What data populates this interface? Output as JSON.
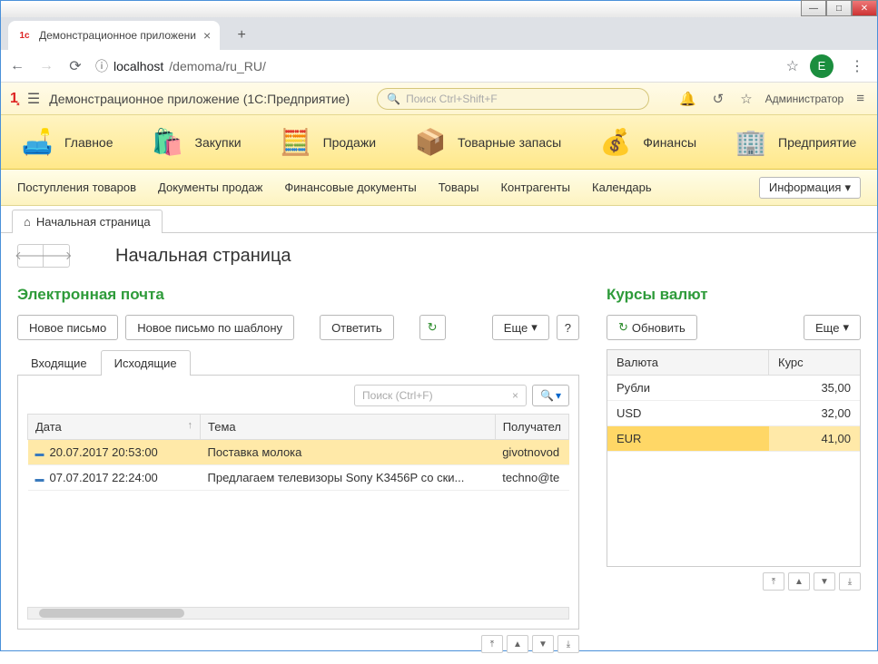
{
  "browser": {
    "tab_title": "Демонстрационное приложени",
    "url_host": "localhost",
    "url_path": "/demoma/ru_RU/",
    "avatar_letter": "Е"
  },
  "header": {
    "app_title": "Демонстрационное приложение  (1С:Предприятие)",
    "search_placeholder": "Поиск Ctrl+Shift+F",
    "user": "Администратор"
  },
  "sections": [
    {
      "label": "Главное",
      "icon": "🛋️"
    },
    {
      "label": "Закупки",
      "icon": "🛍️"
    },
    {
      "label": "Продажи",
      "icon": "🧮"
    },
    {
      "label": "Товарные запасы",
      "icon": "📦"
    },
    {
      "label": "Финансы",
      "icon": "💰"
    },
    {
      "label": "Предприятие",
      "icon": "🏢"
    }
  ],
  "commands": {
    "items": [
      "Поступления товаров",
      "Документы продаж",
      "Финансовые документы",
      "Товары",
      "Контрагенты",
      "Календарь"
    ],
    "info_btn": "Информация"
  },
  "page_tab": "Начальная страница",
  "page_title": "Начальная страница",
  "email": {
    "title": "Электронная почта",
    "new_btn": "Новое письмо",
    "new_tpl_btn": "Новое письмо по шаблону",
    "reply_btn": "Ответить",
    "more_btn": "Еще",
    "help_btn": "?",
    "tab_inbox": "Входящие",
    "tab_outbox": "Исходящие",
    "search_placeholder": "Поиск (Ctrl+F)",
    "col_date": "Дата",
    "col_subject": "Тема",
    "col_recipient": "Получател",
    "rows": [
      {
        "date": "20.07.2017 20:53:00",
        "subject": "Поставка молока",
        "recipient": "givotnovod"
      },
      {
        "date": "07.07.2017 22:24:00",
        "subject": "Предлагаем телевизоры Sony K3456P со ски...",
        "recipient": "techno@te"
      }
    ]
  },
  "rates": {
    "title": "Курсы валют",
    "refresh_btn": "Обновить",
    "more_btn": "Еще",
    "col_currency": "Валюта",
    "col_rate": "Курс",
    "rows": [
      {
        "currency": "Рубли",
        "rate": "35,00"
      },
      {
        "currency": "USD",
        "rate": "32,00"
      },
      {
        "currency": "EUR",
        "rate": "41,00"
      }
    ]
  }
}
